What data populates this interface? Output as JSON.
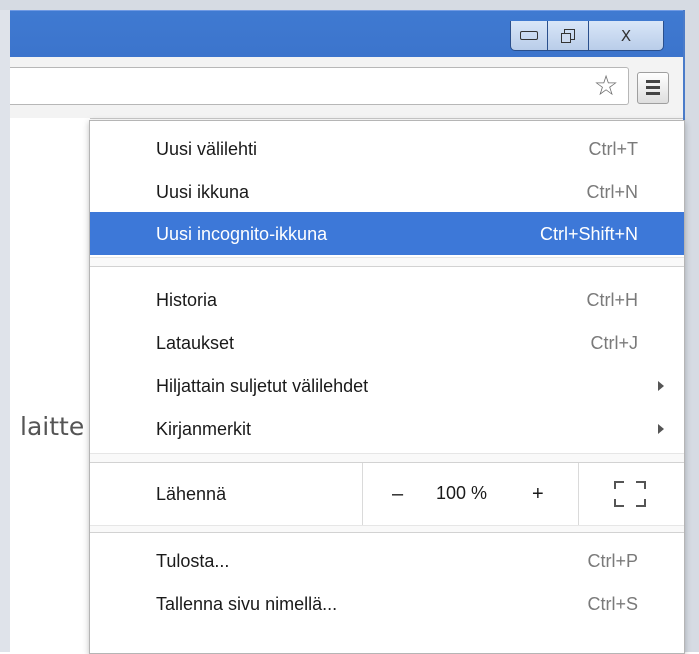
{
  "window": {
    "minimize_icon": "minimize-icon",
    "maximize_icon": "restore-icon",
    "close_label": "X"
  },
  "toolbar": {
    "bookmark_star_icon": "star-outline-icon",
    "menu_icon": "hamburger-menu-icon"
  },
  "page": {
    "visible_text": "laitte"
  },
  "menu": {
    "group1": [
      {
        "label": "Uusi välilehti",
        "shortcut": "Ctrl+T"
      },
      {
        "label": "Uusi ikkuna",
        "shortcut": "Ctrl+N"
      },
      {
        "label": "Uusi incognito-ikkuna",
        "shortcut": "Ctrl+Shift+N",
        "highlighted": true
      }
    ],
    "group2": [
      {
        "label": "Historia",
        "shortcut": "Ctrl+H"
      },
      {
        "label": "Lataukset",
        "shortcut": "Ctrl+J"
      },
      {
        "label": "Hiljattain suljetut välilehdet",
        "submenu": true
      },
      {
        "label": "Kirjanmerkit",
        "submenu": true
      }
    ],
    "zoom": {
      "label": "Lähennä",
      "minus": "–",
      "value": "100 %",
      "plus": "+",
      "fullscreen_icon": "fullscreen-icon"
    },
    "group3": [
      {
        "label": "Tulosta...",
        "shortcut": "Ctrl+P"
      },
      {
        "label": "Tallenna sivu nimellä...",
        "shortcut": "Ctrl+S"
      }
    ]
  },
  "colors": {
    "titlebar": "#3f7ad1",
    "highlight": "#3d78d8",
    "toolbar": "#f3f3f3"
  }
}
